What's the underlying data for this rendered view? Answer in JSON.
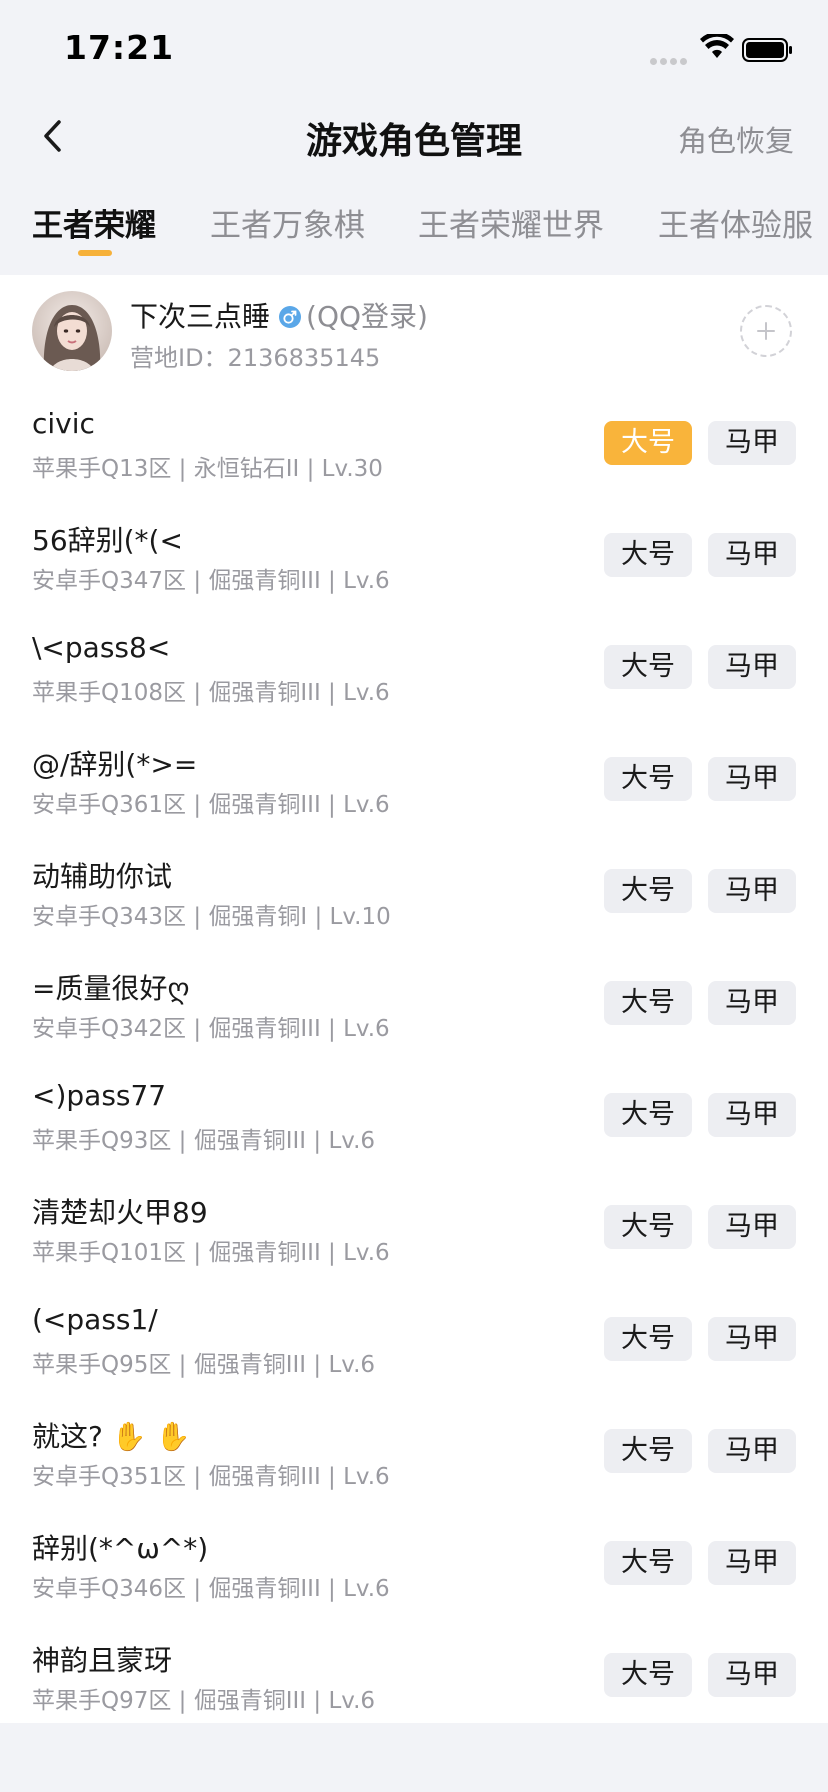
{
  "status_bar": {
    "time": "17:21"
  },
  "nav": {
    "title": "游戏角色管理",
    "action_label": "角色恢复"
  },
  "tabs": [
    {
      "label": "王者荣耀",
      "active": true
    },
    {
      "label": "王者万象棋",
      "active": false
    },
    {
      "label": "王者荣耀世界",
      "active": false
    },
    {
      "label": "王者体验服",
      "active": false
    }
  ],
  "profile": {
    "name": "下次三点睡",
    "login": "(QQ登录)",
    "id_text": "营地ID：2136835145",
    "gender_icon": "male-icon"
  },
  "colors": {
    "accent": "#f9b43b",
    "tag_bg": "#edeef2",
    "muted_text": "#9a9aa0"
  },
  "roles": [
    {
      "name": "civic",
      "detail": "苹果手Q13区 | 永恒钻石II | Lv.30",
      "main_label": "大号",
      "alt_label": "马甲",
      "is_main": true
    },
    {
      "name": "56辞别(*(<",
      "detail": "安卓手Q347区 | 倔强青铜III | Lv.6",
      "main_label": "大号",
      "alt_label": "马甲",
      "is_main": false
    },
    {
      "name": "\\<pass8<",
      "detail": "苹果手Q108区 | 倔强青铜III | Lv.6",
      "main_label": "大号",
      "alt_label": "马甲",
      "is_main": false
    },
    {
      "name": "@/辞别(*>=",
      "detail": "安卓手Q361区 | 倔强青铜III | Lv.6",
      "main_label": "大号",
      "alt_label": "马甲",
      "is_main": false
    },
    {
      "name": "动辅助你试",
      "detail": "安卓手Q343区 | 倔强青铜I | Lv.10",
      "main_label": "大号",
      "alt_label": "马甲",
      "is_main": false
    },
    {
      "name": "=质量很好ღ",
      "detail": "安卓手Q342区 | 倔强青铜III | Lv.6",
      "main_label": "大号",
      "alt_label": "马甲",
      "is_main": false
    },
    {
      "name": "<)pass77",
      "detail": "苹果手Q93区 | 倔强青铜III | Lv.6",
      "main_label": "大号",
      "alt_label": "马甲",
      "is_main": false
    },
    {
      "name": "清楚却火甲89",
      "detail": "苹果手Q101区 | 倔强青铜III | Lv.6",
      "main_label": "大号",
      "alt_label": "马甲",
      "is_main": false
    },
    {
      "name": "(<pass1/",
      "detail": "苹果手Q95区 | 倔强青铜III | Lv.6",
      "main_label": "大号",
      "alt_label": "马甲",
      "is_main": false
    },
    {
      "name": "就这? ✋ ✋",
      "detail": "安卓手Q351区 | 倔强青铜III | Lv.6",
      "main_label": "大号",
      "alt_label": "马甲",
      "is_main": false
    },
    {
      "name": "辞别(*^ω^*)",
      "detail": "安卓手Q346区 | 倔强青铜III | Lv.6",
      "main_label": "大号",
      "alt_label": "马甲",
      "is_main": false
    },
    {
      "name": "神韵且蒙玡",
      "detail": "苹果手Q97区 | 倔强青铜III | Lv.6",
      "main_label": "大号",
      "alt_label": "马甲",
      "is_main": false
    }
  ]
}
